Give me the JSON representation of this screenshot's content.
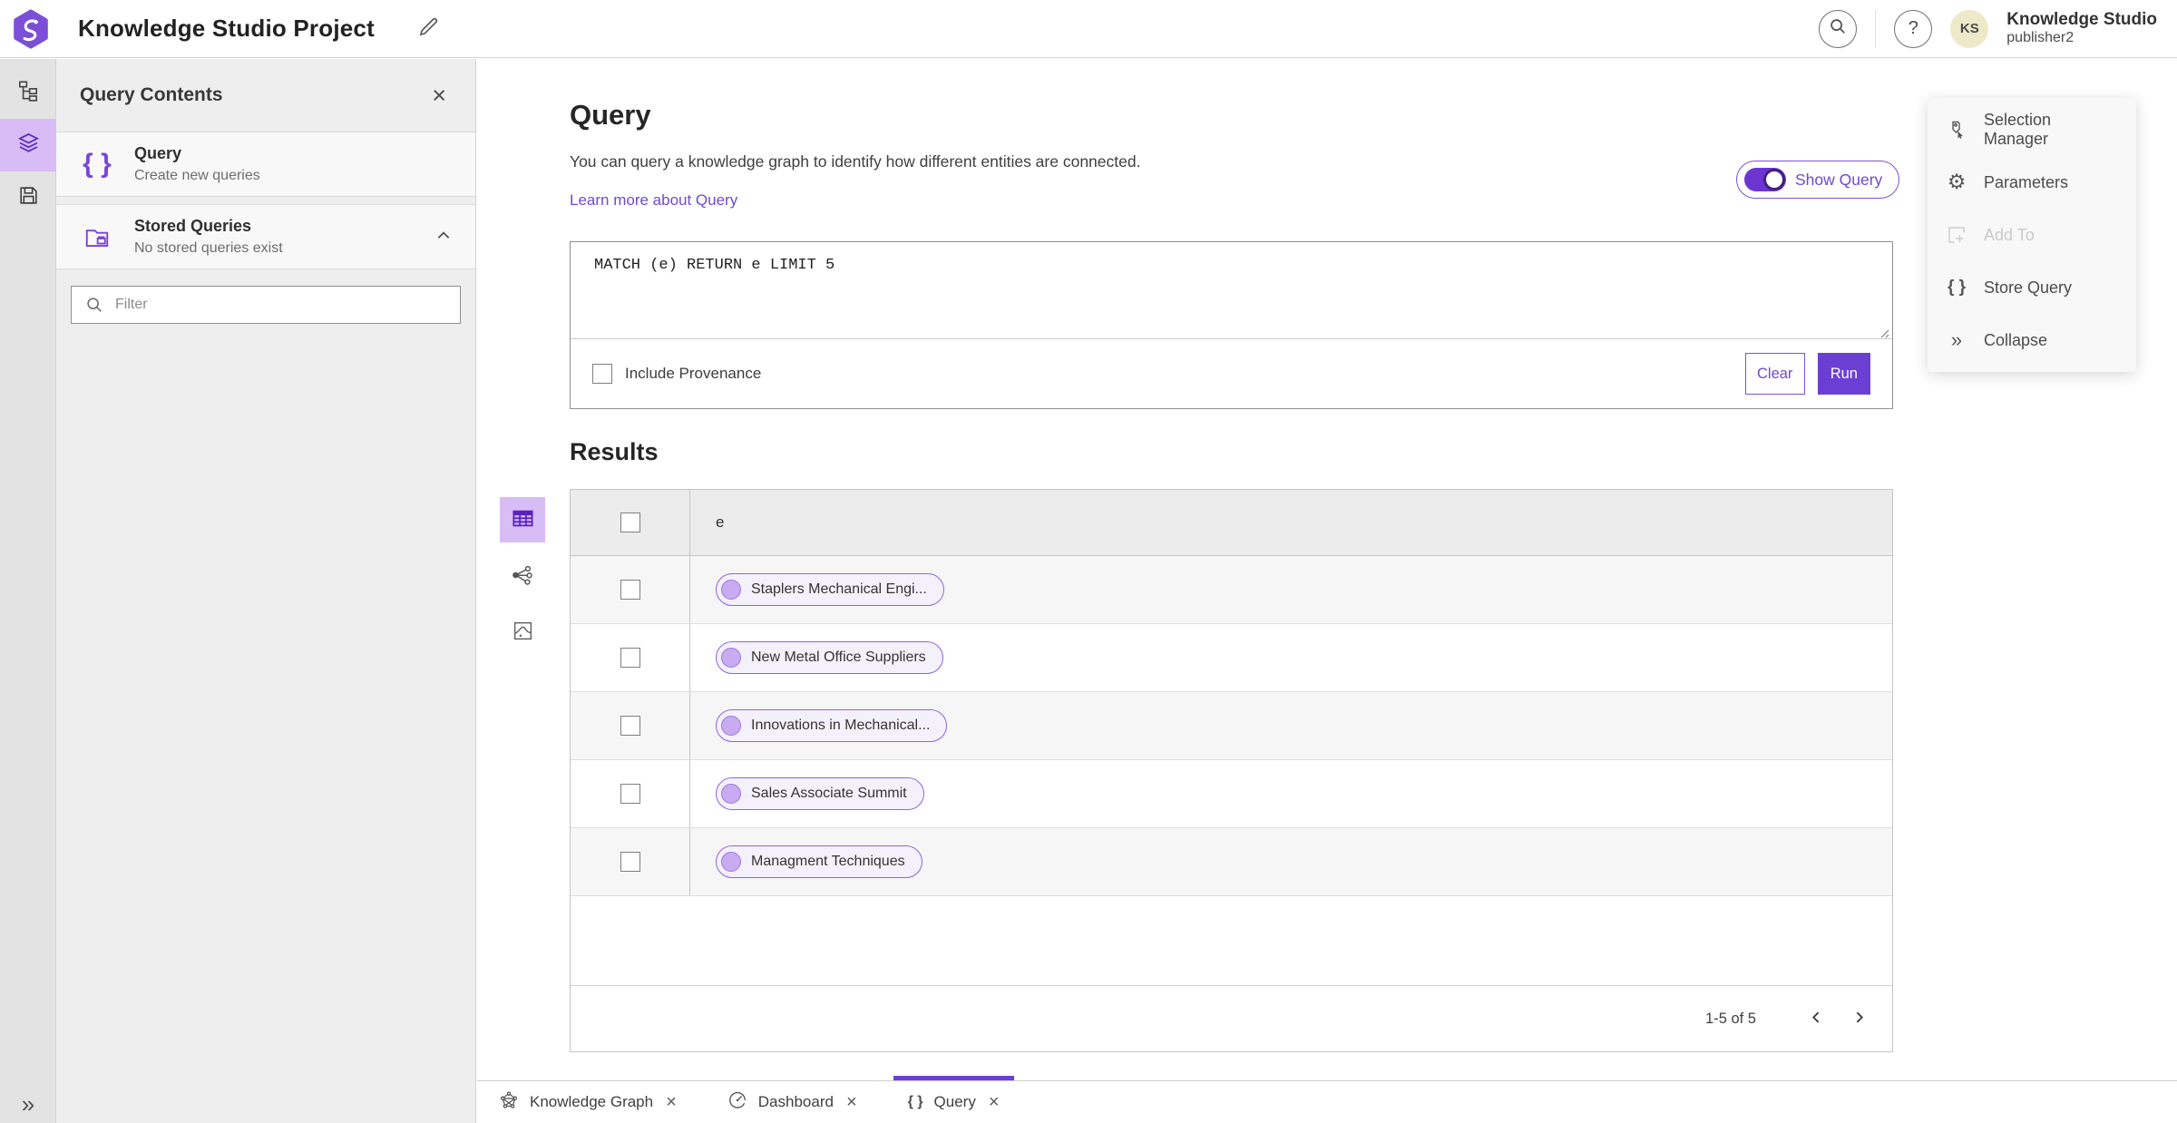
{
  "header": {
    "title": "Knowledge Studio Project",
    "user_initials": "KS",
    "user_name": "Knowledge Studio",
    "user_role": "publisher2"
  },
  "panel": {
    "title": "Query Contents",
    "items": [
      {
        "title": "Query",
        "subtitle": "Create new queries"
      },
      {
        "title": "Stored Queries",
        "subtitle": "No stored queries exist"
      }
    ],
    "filter_placeholder": "Filter"
  },
  "query_section": {
    "heading": "Query",
    "description": "You can query a knowledge graph to identify how different entities are connected.",
    "link_label": "Learn more about Query",
    "toggle_label": "Show Query",
    "toggle_state": "on",
    "query_text": "MATCH (e) RETURN e LIMIT 5",
    "checkbox_label": "Include Provenance",
    "checkbox_checked": false,
    "clear_label": "Clear",
    "run_label": "Run"
  },
  "results": {
    "heading": "Results",
    "column_header": "e",
    "rows": [
      "Staplers Mechanical Engi...",
      "New Metal Office Suppliers",
      "Innovations in Mechanical...",
      "Sales Associate Summit",
      "Managment Techniques"
    ],
    "pagination_label": "1-5 of 5"
  },
  "context_menu": {
    "items": [
      {
        "label": "Selection Manager",
        "disabled": false
      },
      {
        "label": "Parameters",
        "disabled": false
      },
      {
        "label": "Add To",
        "disabled": true
      },
      {
        "label": "Store Query",
        "disabled": false
      },
      {
        "label": "Collapse",
        "disabled": false
      }
    ]
  },
  "tabs": [
    {
      "label": "Knowledge Graph",
      "active": false
    },
    {
      "label": "Dashboard",
      "active": false
    },
    {
      "label": "Query",
      "active": true
    }
  ],
  "icons": {
    "help": "?",
    "close": "×",
    "braces": "{ }",
    "collapse": "»",
    "expand": "»"
  },
  "colors": {
    "accent": "#6c3fd4",
    "accent_light": "#d8bcf6",
    "link": "#6e4ad0",
    "pill_bg": "#f5f1fc",
    "pill_border": "#8b66dd",
    "node_fill": "#c8abf0",
    "avatar_bg": "#eee9c9"
  }
}
